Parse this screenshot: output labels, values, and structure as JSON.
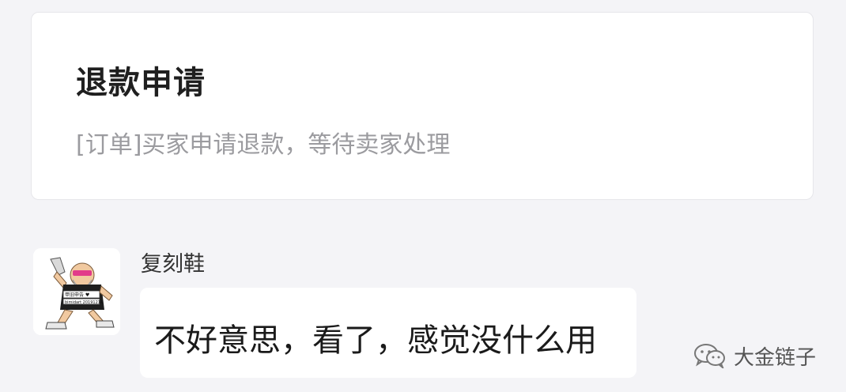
{
  "refund_card": {
    "title": "退款申请",
    "description": "[订单]买家申请退款，等待卖家处理"
  },
  "message": {
    "sender_name": "复刻鞋",
    "avatar_icon": "cartoon-old-man-avatar",
    "avatar_badge_line1": "甲旧申告 ♥",
    "avatar_badge_line2": "bimidart 20191214",
    "text": "不好意思，看了，感觉没什么用"
  },
  "watermark": {
    "icon": "wechat-logo-icon",
    "text": "大金链子"
  },
  "colors": {
    "background": "#f4f4f7",
    "card": "#ffffff",
    "title": "#1f1f1f",
    "description": "#9b9b9f",
    "message_text": "#1a1a1a"
  }
}
